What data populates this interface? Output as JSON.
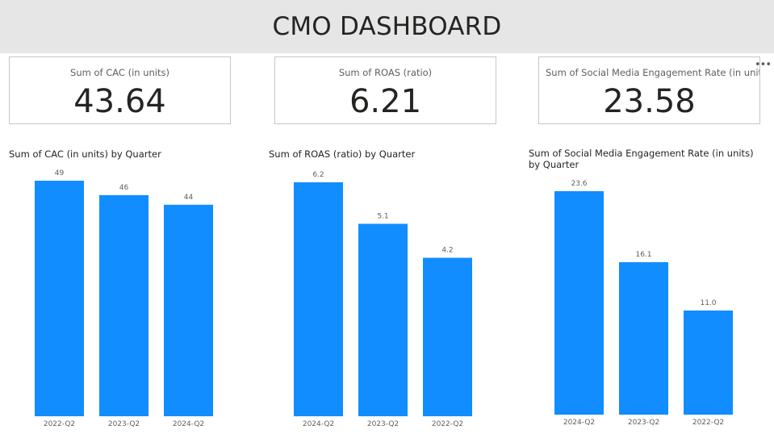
{
  "header": {
    "title": "CMO DASHBOARD"
  },
  "cards": [
    {
      "label": "Sum of CAC (in units)",
      "value": "43.64"
    },
    {
      "label": "Sum of ROAS (ratio)",
      "value": "6.21"
    },
    {
      "label": "Sum of Social Media Engagement Rate (in units)",
      "value": "23.58"
    }
  ],
  "more_icon": "more-options-icon",
  "colors": {
    "bar": "#118dff",
    "header_bg": "#e6e6e6"
  },
  "chart_data": [
    {
      "type": "bar",
      "title": "Sum of CAC (in units) by Quarter",
      "categories": [
        "2022-Q2",
        "2023-Q2",
        "2024-Q2"
      ],
      "values": [
        49,
        46,
        44
      ],
      "data_labels": [
        "49",
        "46",
        "44"
      ]
    },
    {
      "type": "bar",
      "title": "Sum of ROAS (ratio) by Quarter",
      "categories": [
        "2024-Q2",
        "2023-Q2",
        "2022-Q2"
      ],
      "values": [
        6.2,
        5.1,
        4.2
      ],
      "data_labels": [
        "6.2",
        "5.1",
        "4.2"
      ]
    },
    {
      "type": "bar",
      "title": "Sum of Social Media Engagement Rate (in units) by Quarter",
      "categories": [
        "2024-Q2",
        "2023-Q2",
        "2022-Q2"
      ],
      "values": [
        23.6,
        16.1,
        11.0
      ],
      "data_labels": [
        "23.6",
        "16.1",
        "11.0"
      ]
    }
  ]
}
